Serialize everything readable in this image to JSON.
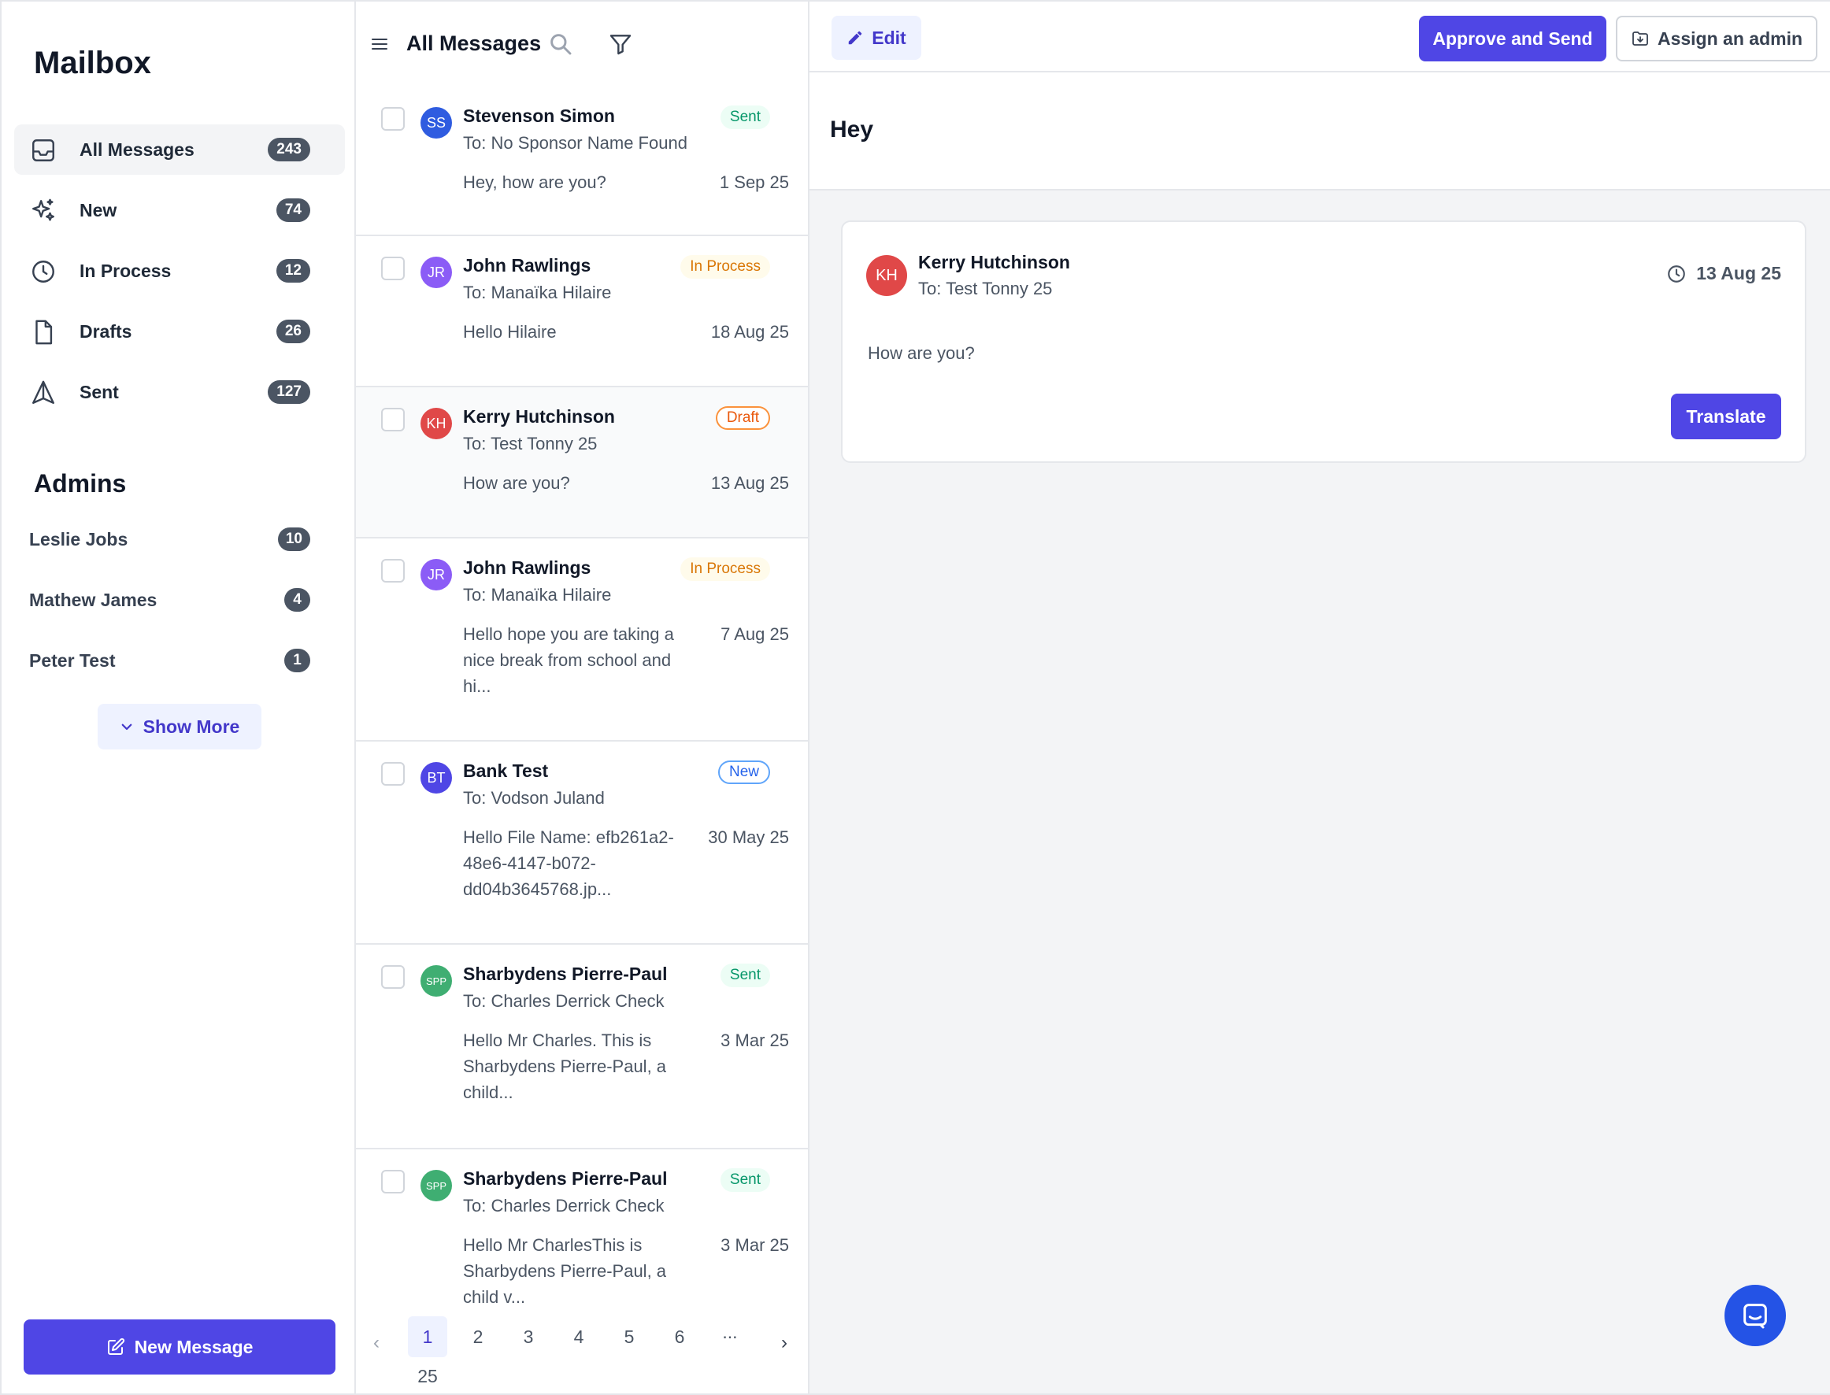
{
  "sidebar": {
    "title": "Mailbox",
    "nav": [
      {
        "label": "All Messages",
        "count": "243",
        "icon": "inbox-icon"
      },
      {
        "label": "New",
        "count": "74",
        "icon": "sparkle-icon"
      },
      {
        "label": "In Process",
        "count": "12",
        "icon": "clock-icon"
      },
      {
        "label": "Drafts",
        "count": "26",
        "icon": "document-icon"
      },
      {
        "label": "Sent",
        "count": "127",
        "icon": "send-icon"
      }
    ],
    "admins_title": "Admins",
    "admins": [
      {
        "label": "Leslie Jobs",
        "count": "10"
      },
      {
        "label": "Mathew James",
        "count": "4"
      },
      {
        "label": "Peter Test",
        "count": "1"
      }
    ],
    "show_more": "Show More",
    "new_message": "New Message"
  },
  "list": {
    "title": "All Messages",
    "messages": [
      {
        "initials": "SS",
        "avatar_color": "#2f5ce0",
        "sender": "Stevenson Simon",
        "to": "To: No Sponsor Name Found",
        "preview": "Hey, how are you?",
        "date": "1 Sep 25",
        "status": "Sent"
      },
      {
        "initials": "JR",
        "avatar_color": "#8b5cf6",
        "sender": "John Rawlings",
        "to": "To: Manaïka Hilaire",
        "preview": "Hello Hilaire",
        "date": "18 Aug 25",
        "status": "In Process"
      },
      {
        "initials": "KH",
        "avatar_color": "#e04848",
        "sender": "Kerry Hutchinson",
        "to": "To: Test Tonny 25",
        "preview": "How are you?",
        "date": "13 Aug 25",
        "status": "Draft"
      },
      {
        "initials": "JR",
        "avatar_color": "#8b5cf6",
        "sender": "John Rawlings",
        "to": "To: Manaïka Hilaire",
        "preview": "Hello hope you are taking a nice break from school and hi...",
        "date": "7 Aug 25",
        "status": "In Process"
      },
      {
        "initials": "BT",
        "avatar_color": "#4f46e5",
        "sender": "Bank Test",
        "to": "To: Vodson Juland",
        "preview": "Hello File Name: efb261a2-48e6-4147-b072-dd04b3645768.jp...",
        "date": "30 May 25",
        "status": "New"
      },
      {
        "initials": "SPP",
        "avatar_color": "#3fae72",
        "sender": "Sharbydens Pierre-Paul",
        "to": "To: Charles Derrick Check",
        "preview": "Hello Mr Charles. This is Sharbydens Pierre-Paul, a child...",
        "date": "3 Mar 25",
        "status": "Sent"
      },
      {
        "initials": "SPP",
        "avatar_color": "#3fae72",
        "sender": "Sharbydens Pierre-Paul",
        "to": "To: Charles Derrick Check",
        "preview": "Hello Mr CharlesThis is Sharbydens Pierre-Paul, a child v...",
        "date": "3 Mar 25",
        "status": "Sent"
      }
    ],
    "pagination": {
      "pages": [
        "1",
        "2",
        "3",
        "4",
        "5",
        "6",
        "..."
      ],
      "last": "25",
      "current": "1"
    }
  },
  "detail": {
    "edit": "Edit",
    "approve": "Approve and Send",
    "assign": "Assign an admin",
    "subject": "Hey",
    "message": {
      "initials": "KH",
      "sender": "Kerry Hutchinson",
      "to": "To: Test Tonny 25",
      "date": "13 Aug 25",
      "body": "How are you?"
    },
    "translate": "Translate"
  },
  "colors": {
    "primary": "#4f46e5",
    "sent": "#059669",
    "in_process": "#d97706",
    "draft": "#ea580c",
    "new": "#2563eb"
  }
}
